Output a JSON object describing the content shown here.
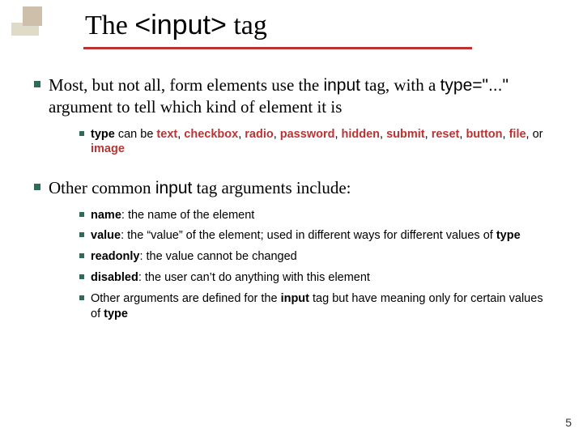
{
  "title": {
    "t0": "The ",
    "t1": "<input>",
    "t2": " tag"
  },
  "b1": {
    "a": "Most, but not all, form elements use the ",
    "b": "input",
    "c": " tag, with a ",
    "d": "type=\"...\"",
    "e": " argument to tell which kind of element it is"
  },
  "b1s1": {
    "a": "type",
    "b": " can be ",
    "c": "text",
    "d": ", ",
    "e": "checkbox",
    "f": ", ",
    "g": "radio",
    "h": ", ",
    "i": "password",
    "j": ", ",
    "k": "hidden",
    "l": ", ",
    "m": "submit",
    "n": ", ",
    "o": "reset",
    "p": ", ",
    "q": "button",
    "r": ", ",
    "s": "file",
    "t": ", or ",
    "u": "image"
  },
  "b2": {
    "a": "Other common ",
    "b": "input",
    "c": " tag arguments include:"
  },
  "b2s1": {
    "a": "name",
    "b": ": the name of the element"
  },
  "b2s2": {
    "a": "value",
    "b": ": the “value” of the element; used in different ways for different values of ",
    "c": "type"
  },
  "b2s3": {
    "a": "readonly",
    "b": ": the value cannot be changed"
  },
  "b2s4": {
    "a": "disabled",
    "b": ": the user can’t do anything with this element"
  },
  "b2s5": {
    "a": "Other arguments are defined for the ",
    "b": "input",
    "c": " tag but have meaning only for certain values of ",
    "d": "type"
  },
  "page": "5"
}
